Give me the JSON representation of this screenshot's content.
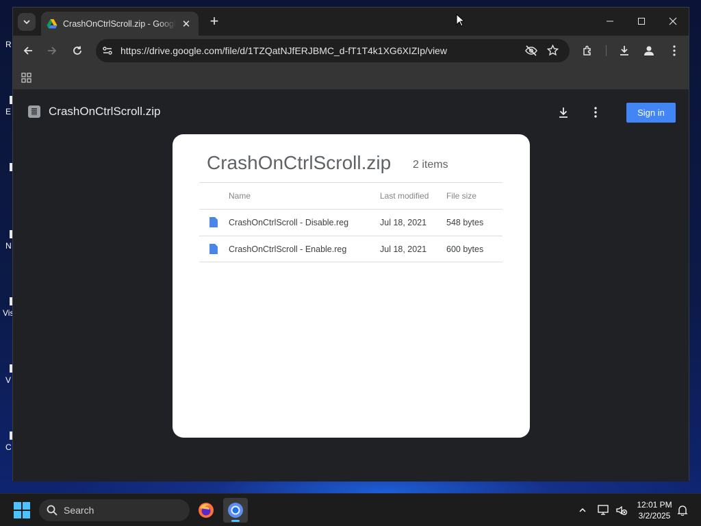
{
  "desktop": {
    "icons": [
      {
        "label": "R"
      },
      {
        "label": "E"
      },
      {
        "label": ""
      },
      {
        "label": "N"
      },
      {
        "label": "Vis"
      },
      {
        "label": "V"
      },
      {
        "label": "C"
      }
    ]
  },
  "browser": {
    "tab": {
      "title": "CrashOnCtrlScroll.zip - Google Drive",
      "favicon": "google-drive-icon"
    },
    "url": "https://drive.google.com/file/d/1TZQatNJfERJBMC_d-fT1T4k1XG6XIZIp/view",
    "window_controls": [
      "minimize",
      "maximize",
      "close"
    ]
  },
  "viewer": {
    "file_title": "CrashOnCtrlScroll.zip",
    "sign_in_label": "Sign in",
    "accent_color": "#4285f4"
  },
  "archive": {
    "name": "CrashOnCtrlScroll.zip",
    "count": "2 items",
    "columns": {
      "name": "Name",
      "modified": "Last modified",
      "size": "File size"
    },
    "files": [
      {
        "name": "CrashOnCtrlScroll - Disable.reg",
        "modified": "Jul 18, 2021",
        "size": "548 bytes"
      },
      {
        "name": "CrashOnCtrlScroll - Enable.reg",
        "modified": "Jul 18, 2021",
        "size": "600 bytes"
      }
    ]
  },
  "taskbar": {
    "search_label": "Search",
    "time": "12:01 PM",
    "date": "3/2/2025"
  }
}
